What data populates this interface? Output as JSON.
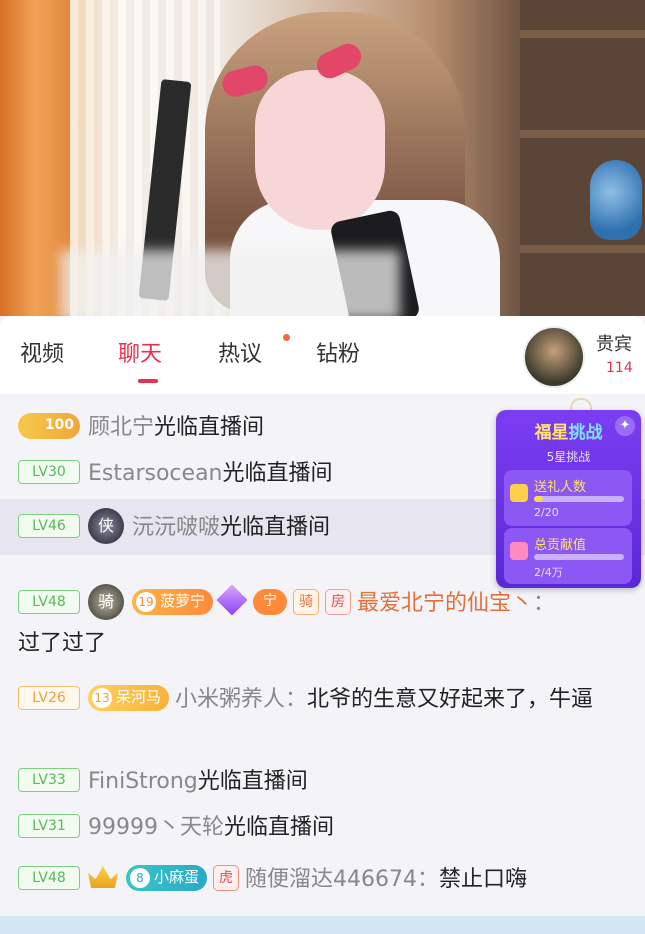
{
  "tabs": [
    {
      "label": "视频"
    },
    {
      "label": "聊天"
    },
    {
      "label": "热议"
    },
    {
      "label": "钻粉"
    }
  ],
  "guest": {
    "label": "贵宾",
    "count": "114"
  },
  "challenge": {
    "title_part1": "福星",
    "title_part2": "挑战",
    "subtitle": "5星挑战",
    "items": [
      {
        "label": "送礼人数",
        "value": "2/20",
        "progress": 0.1
      },
      {
        "label": "总贡献值",
        "value": "2/4万",
        "progress": 0.0
      }
    ]
  },
  "messages": {
    "m1": {
      "badge": "100",
      "user": "顾北宁",
      "action": "光临直播间"
    },
    "m2": {
      "level": "LV30",
      "user": "Estarsocean",
      "action": "光临直播间"
    },
    "m3": {
      "level": "LV46",
      "shield": "侠",
      "user": "沅沅啵啵",
      "action": "光临直播间"
    },
    "m4": {
      "level": "LV48",
      "shield": "骑",
      "fan_num": "19",
      "fan_name": "菠萝宁",
      "tag1": "宁",
      "tag2": "骑",
      "tag3": "房",
      "user": "最爱北宁的仙宝丶",
      "colon": "：",
      "content": "过了过了"
    },
    "m5": {
      "level": "LV26",
      "fan_num": "13",
      "fan_name": "呆河马",
      "user": "小米粥养人",
      "colon": "：",
      "content": "北爷的生意又好起来了，牛逼"
    },
    "m6": {
      "level": "LV33",
      "user": "FiniStrong",
      "action": "光临直播间"
    },
    "m7": {
      "level": "LV31",
      "user": "99999丶天轮",
      "action": "光临直播间"
    },
    "m8": {
      "level": "LV48",
      "fan_num": "8",
      "fan_name": "小麻蛋",
      "tag1": "虎",
      "user": "随便溜达446674",
      "colon": "：",
      "content": "禁止口嗨"
    }
  },
  "colors": {
    "accent": "#e6304f",
    "level_green": "#58b95c",
    "challenge_purple": "#6a32e4"
  }
}
